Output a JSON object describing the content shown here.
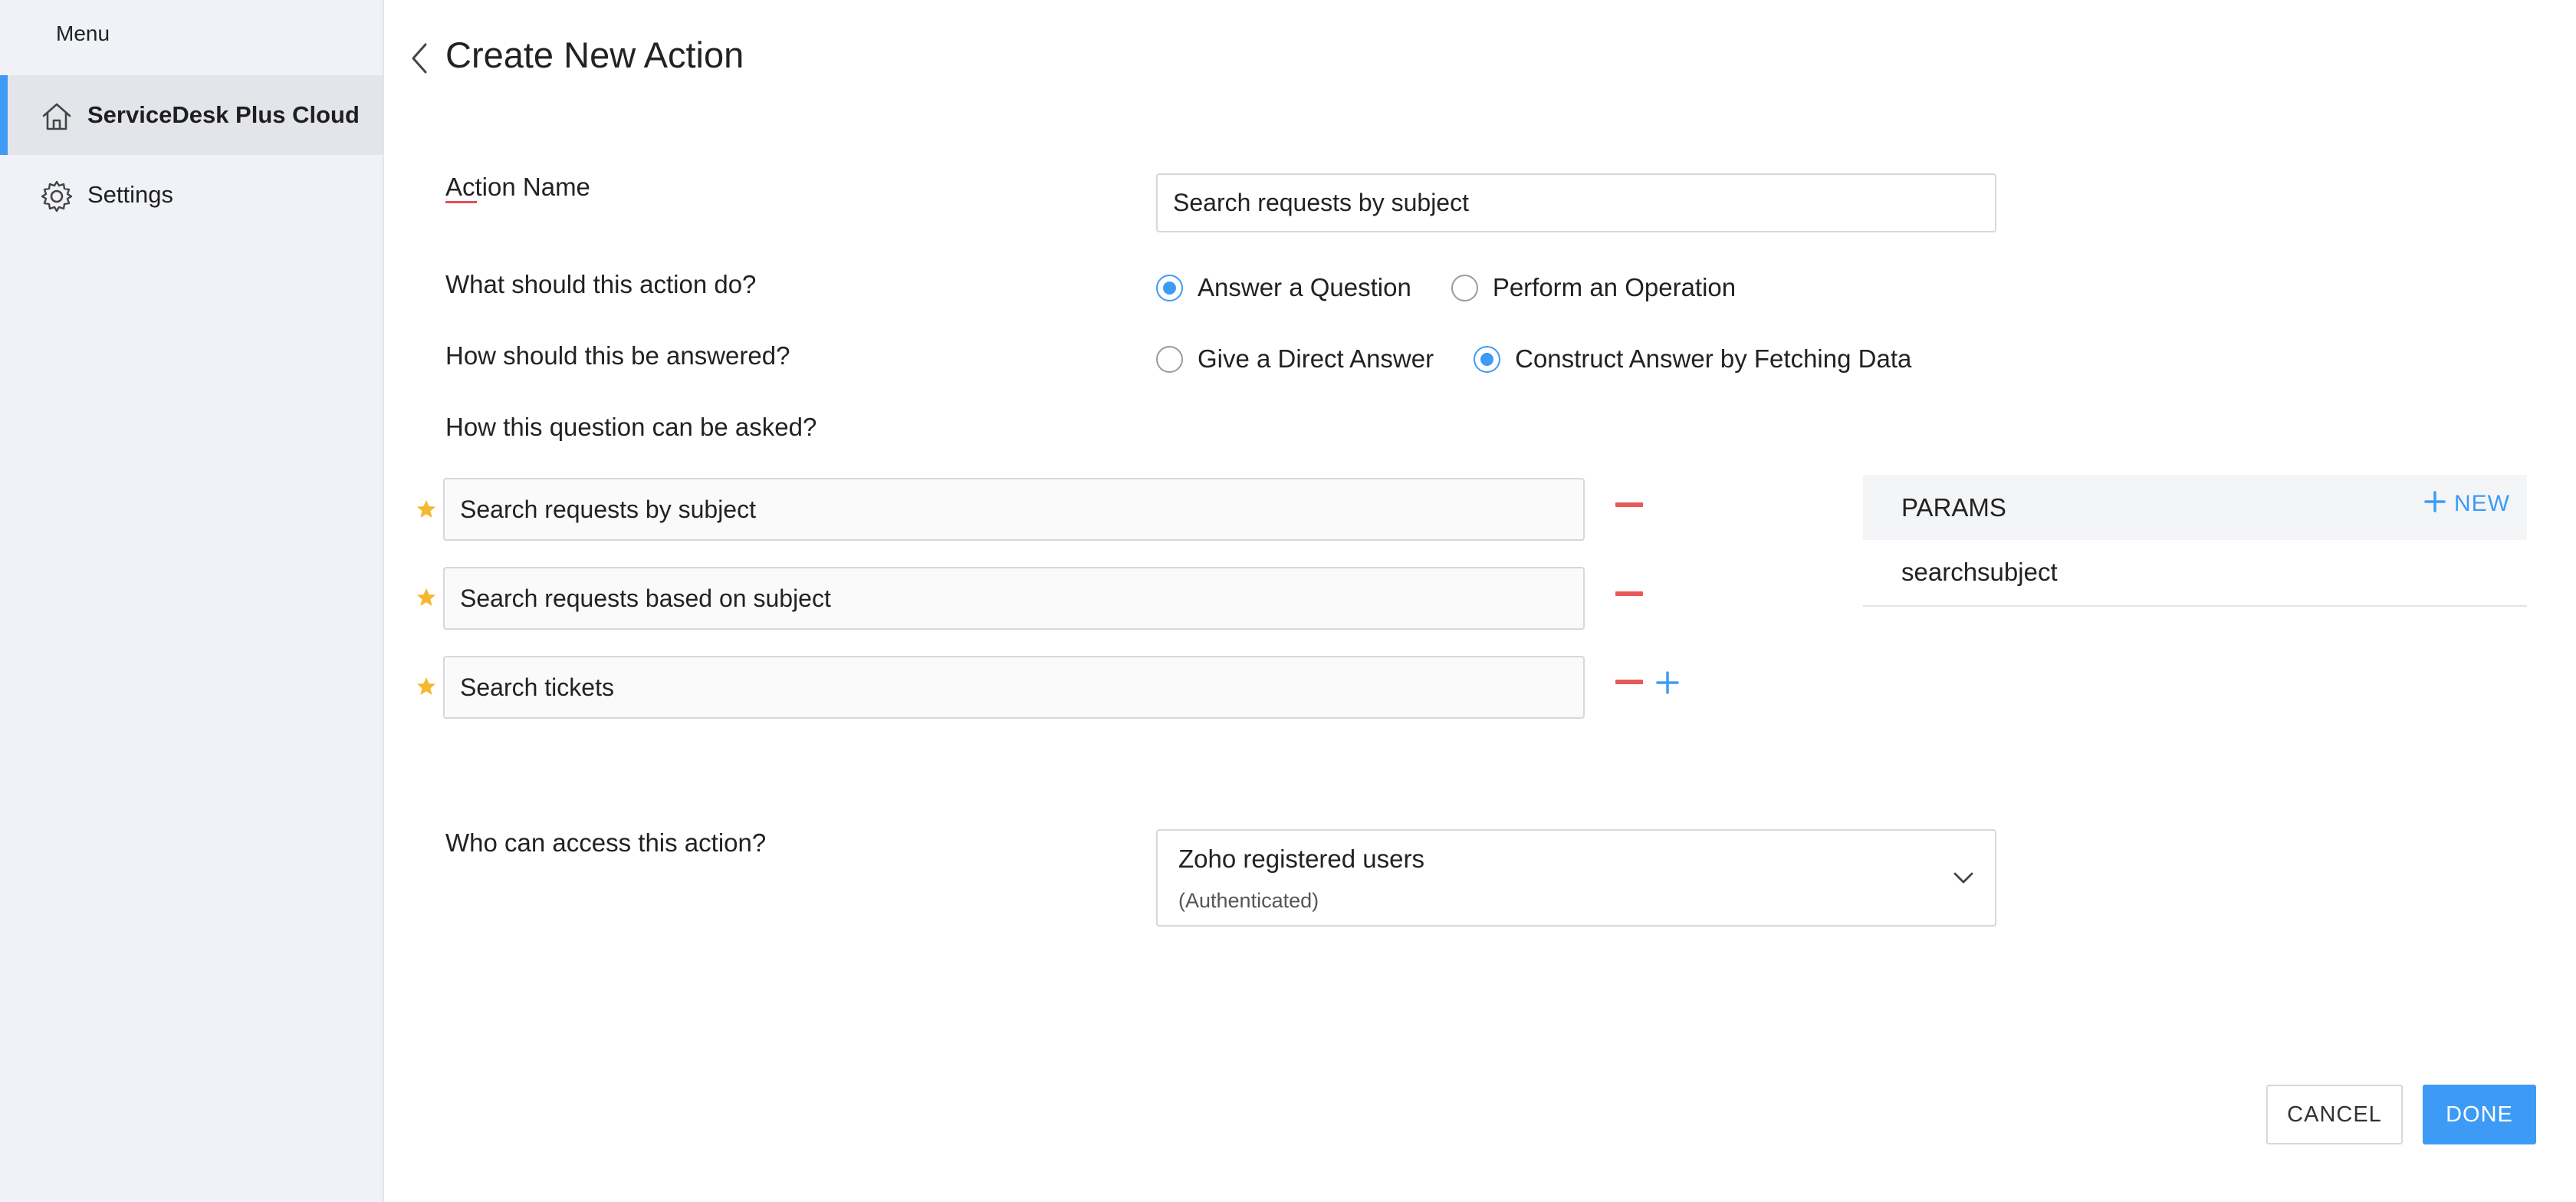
{
  "sidebar": {
    "menu_label": "Menu",
    "items": [
      {
        "label": "ServiceDesk Plus Cloud",
        "icon": "home-icon",
        "active": true
      },
      {
        "label": "Settings",
        "icon": "gear-icon",
        "active": false
      }
    ]
  },
  "header": {
    "title": "Create New Action"
  },
  "form": {
    "action_name": {
      "label": "Action Name",
      "value": "Search requests by subject"
    },
    "action_type": {
      "label": "What should this action do?",
      "options": [
        "Answer a Question",
        "Perform an Operation"
      ],
      "selected": "Answer a Question"
    },
    "answer_type": {
      "label": "How should this be answered?",
      "options": [
        "Give a Direct Answer",
        "Construct Answer by Fetching Data"
      ],
      "selected": "Construct Answer by Fetching Data"
    },
    "questions": {
      "label": "How this question can be asked?",
      "items": [
        "Search requests by subject",
        "Search requests based on subject",
        "Search tickets"
      ]
    },
    "access": {
      "label": "Who can access this action?",
      "value": "Zoho registered users",
      "subtext": "(Authenticated)"
    }
  },
  "params": {
    "title": "PARAMS",
    "new_label": "NEW",
    "items": [
      "searchsubject"
    ]
  },
  "footer": {
    "cancel_label": "CANCEL",
    "done_label": "DONE"
  },
  "colors": {
    "accent": "#3d9bf5",
    "remove": "#e65a5a",
    "star": "#f5b82e",
    "sidebar_bg": "#f0f2f7"
  }
}
